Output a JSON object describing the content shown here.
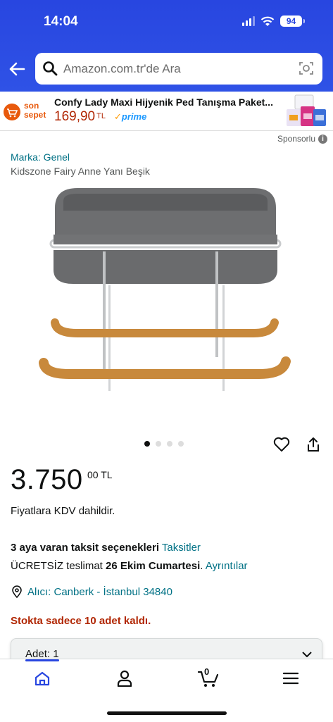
{
  "status_bar": {
    "time": "14:04",
    "battery": "94"
  },
  "header": {
    "search_placeholder": "Amazon.com.tr'de Ara"
  },
  "banner": {
    "logo_text_line1": "son",
    "logo_text_line2": "sepet",
    "title": "Confy Lady Maxi Hijyenik Ped Tanışma Paket...",
    "price": "169,90",
    "currency": "TL",
    "prime": "prime"
  },
  "sponsored_label": "Sponsorlu",
  "product": {
    "brand": "Marka: Genel",
    "title": "Kidszone Fairy Anne Yanı Beşik",
    "price_main": "3.750",
    "price_fraction": "00",
    "price_currency": "TL",
    "vat_note": "Fiyatlara KDV dahildir.",
    "installment_text": "3 aya varan taksit seçenekleri",
    "installment_link": "Taksitler",
    "delivery_prefix": "ÜCRETSİZ teslimat",
    "delivery_date": "26 Ekim Cumartesi",
    "delivery_link": "Ayrıntılar",
    "location": "Alıcı: Canberk - İstanbul 34840",
    "stock": "Stokta sadece 10 adet kaldı.",
    "quantity_label": "Adet:",
    "quantity_value": "1",
    "image_count": 4,
    "active_image": 1
  },
  "bottom_nav": {
    "cart_count": "0"
  },
  "colors": {
    "header_blue": "#2846e0",
    "link": "#007185",
    "price_red": "#b12704",
    "prime_blue": "#1a98ff"
  }
}
